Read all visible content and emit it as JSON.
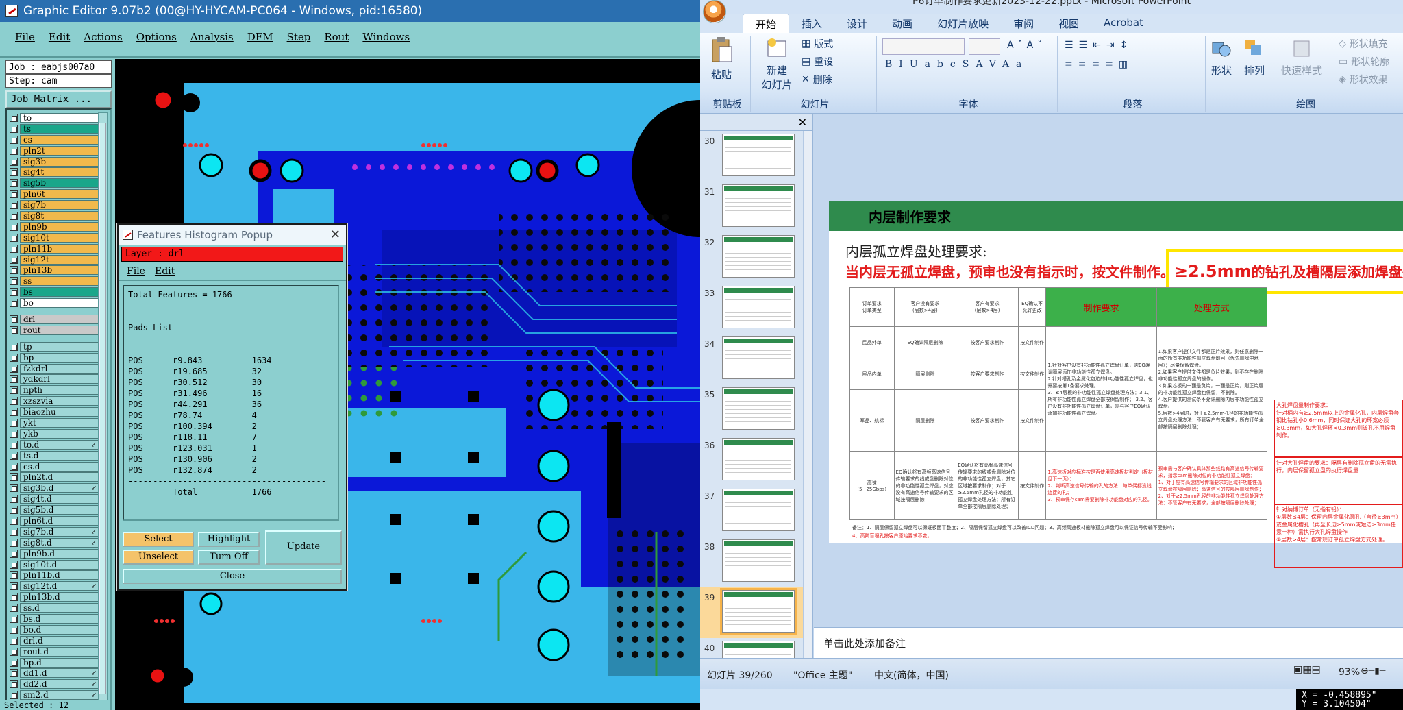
{
  "graphic_editor": {
    "title": "Graphic Editor 9.07b2 (00@HY-HYCAM-PC064 - Windows, pid:16580)",
    "menu": [
      "File",
      "Edit",
      "Actions",
      "Options",
      "Analysis",
      "DFM",
      "Step",
      "Rout",
      "Windows"
    ],
    "job": "Job : eabjs007a0",
    "step": "Step: cam",
    "job_matrix_label": "Job Matrix ...",
    "layers": [
      {
        "name": "to",
        "color": "#ffffff"
      },
      {
        "name": "ts",
        "color": "#1aa68a"
      },
      {
        "name": "cs",
        "color": "#f1b94c"
      },
      {
        "name": "pln2t",
        "color": "#f1b94c"
      },
      {
        "name": "sig3b",
        "color": "#f1b94c"
      },
      {
        "name": "sig4t",
        "color": "#f1b94c"
      },
      {
        "name": "sig5b",
        "color": "#1aa68a"
      },
      {
        "name": "pln6t",
        "color": "#f1b94c"
      },
      {
        "name": "sig7b",
        "color": "#f1b94c"
      },
      {
        "name": "sig8t",
        "color": "#f1b94c"
      },
      {
        "name": "pln9b",
        "color": "#f1b94c"
      },
      {
        "name": "sig10t",
        "color": "#f1b94c"
      },
      {
        "name": "pln11b",
        "color": "#f1b94c"
      },
      {
        "name": "sig12t",
        "color": "#f1b94c"
      },
      {
        "name": "pln13b",
        "color": "#f1b94c"
      },
      {
        "name": "ss",
        "color": "#f1b94c"
      },
      {
        "name": "bs",
        "color": "#1aa68a"
      },
      {
        "name": "bo",
        "color": "#ffffff"
      }
    ],
    "layers_drill": [
      {
        "name": "drl",
        "color": "#c9c9c9"
      },
      {
        "name": "rout",
        "color": "#c9c9c9"
      }
    ],
    "layers_misc": [
      {
        "name": "tp",
        "arrow": ""
      },
      {
        "name": "bp",
        "arrow": ""
      },
      {
        "name": "fzkdrl",
        "arrow": ""
      },
      {
        "name": "ydkdrl",
        "arrow": ""
      },
      {
        "name": "npth",
        "arrow": ""
      },
      {
        "name": "xzszvia",
        "arrow": ""
      },
      {
        "name": "biaozhu",
        "arrow": ""
      },
      {
        "name": "ykt",
        "arrow": ""
      },
      {
        "name": "ykb",
        "arrow": ""
      },
      {
        "name": "to.d",
        "arrow": "↙"
      },
      {
        "name": "ts.d",
        "arrow": ""
      },
      {
        "name": "cs.d",
        "arrow": ""
      },
      {
        "name": "pln2t.d",
        "arrow": ""
      },
      {
        "name": "sig3b.d",
        "arrow": "↙"
      },
      {
        "name": "sig4t.d",
        "arrow": ""
      },
      {
        "name": "sig5b.d",
        "arrow": ""
      },
      {
        "name": "pln6t.d",
        "arrow": ""
      },
      {
        "name": "sig7b.d",
        "arrow": "↙"
      },
      {
        "name": "sig8t.d",
        "arrow": "↙"
      },
      {
        "name": "pln9b.d",
        "arrow": ""
      },
      {
        "name": "sig10t.d",
        "arrow": ""
      },
      {
        "name": "pln11b.d",
        "arrow": ""
      },
      {
        "name": "sig12t.d",
        "arrow": "↙"
      },
      {
        "name": "pln13b.d",
        "arrow": ""
      },
      {
        "name": "ss.d",
        "arrow": ""
      },
      {
        "name": "bs.d",
        "arrow": ""
      },
      {
        "name": "bo.d",
        "arrow": ""
      },
      {
        "name": "drl.d",
        "arrow": ""
      },
      {
        "name": "rout.d",
        "arrow": ""
      },
      {
        "name": "bp.d",
        "arrow": ""
      },
      {
        "name": "dd1.d",
        "arrow": "↙"
      },
      {
        "name": "dd2.d",
        "arrow": "↙"
      },
      {
        "name": "sm2.d",
        "arrow": "↙"
      }
    ],
    "selected_label": "Selected : 12",
    "coords": {
      "x": "X = -0.458895\"",
      "y": "Y = 3.104504\""
    }
  },
  "popup": {
    "title": "Features Histogram Popup",
    "layer_label": "Layer : drl",
    "menu": [
      "File",
      "Edit"
    ],
    "text": "Total Features = 1766\n\n\nPads List\n---------\n\nPOS      r9.843          1634\nPOS      r19.685         32\nPOS      r30.512         30\nPOS      r31.496         16\nPOS      r44.291         36\nPOS      r78.74          4\nPOS      r100.394        2\nPOS      r118.11         7\nPOS      r123.031        1\nPOS      r130.906        2\nPOS      r132.874        2\n----------------------------------------\n         Total           1766",
    "buttons": {
      "select": "Select",
      "highlight": "Highlight",
      "update": "Update",
      "unselect": "Unselect",
      "turn_off": "Turn Off",
      "close": "Close"
    }
  },
  "powerpoint": {
    "title": "P6订单制作要求更新2023-12-22.pptx - Microsoft PowerPoint",
    "tabs": [
      "开始",
      "插入",
      "设计",
      "动画",
      "幻灯片放映",
      "审阅",
      "视图",
      "Acrobat"
    ],
    "groups": {
      "clipboard": "剪贴板",
      "slides": "幻灯片",
      "font": "字体",
      "paragraph": "段落",
      "drawing": "绘图"
    },
    "buttons": {
      "paste": "粘贴",
      "new_slide_1": "新建",
      "new_slide_2": "幻灯片",
      "layout": "版式",
      "reset": "重设",
      "delete": "删除",
      "shape": "形状",
      "arrange": "排列",
      "quick_style": "快速样式",
      "shape_fill": "形状填充",
      "shape_outline": "形状轮廓",
      "shape_effect": "形状效果"
    },
    "thumb_numbers": [
      "30",
      "31",
      "32",
      "33",
      "34",
      "35",
      "36",
      "37",
      "38",
      "39",
      "40"
    ],
    "slide": {
      "title": "内层制作要求",
      "subtitle": "内层孤立焊盘处理要求:",
      "red_line": "当内层无孤立焊盘，预审也没有指示时，按文件制作。",
      "red_big": "≥2.5mm",
      "red_tail": "的钻孔及槽隔层添加焊盘处理",
      "table_head": [
        "订单要求\n订单类型",
        "客户没有要求\n(层数>4层)",
        "客户有要求\n(层数>4层)",
        "EQ确认不允许更改",
        "制作要求",
        "处理方式"
      ],
      "rows": [
        {
          "type": "民品外单",
          "c1": "EQ确认隔层删除",
          "c2": "按客户要求制作",
          "c3": "按文件制作"
        },
        {
          "type": "民品内单",
          "c1": "隔层删除",
          "c2": "按客户要求制作",
          "c3": "按文件制作"
        },
        {
          "type": "军品、航标",
          "c1": "隔层删除",
          "c2": "按客户要求制作",
          "c3": "按文件制作"
        },
        {
          "type": "高速\n(5~25Gbps)",
          "c1": "EQ确认将有高频高速信号传输要求的线或盘删除对位的非功能性孤立焊盘，对应没有高速信号传输要求的区域按隔层删除",
          "c2": "EQ确认将有高频高速信号传输要求的线或盘删除对位的非功能性孤立焊盘，其它区域按要求制作；对于≥2.5mm孔径的非功能性孤立焊盘处理方法：所有订单全部按隔层删除处理；",
          "c3": "按文件制作"
        }
      ],
      "req_col": "1.针对客户没有非功能性孤立焊盘订单，需EQ确认隔层添加非功能性孤立焊盘。\n2.针对槽孔及金属化包边的非功能性孤立焊盘，也需要按第1条要求处理。\n3、≤4层板的非功能性孤立焊盘处理方法：3.1、所有非功能性孤立焊盘全部按保留制作； 3.2、客户没有非功能性孤立焊盘订单，需与客户EQ确认添加非功能性孤立焊盘。",
      "proc_col": "1.如果客户提供文件都是正片效果，则任意删除一面的所有非功能性孤立焊盘即可（优先删除电地层）；尽量保留焊盘。\n2.如果客户提供文件都是负片效果，则不存在删除非功能性孤立焊盘的操作。\n3.如果芯板的一面是负片，一面是正片，则正片层的非功能性孤立焊盘也保留，不删除。\n4.客户提供的测试条不允许删除内层非功能性孤立焊盘。\n5.层数>4层时，对于≥2.5mm孔径的非功能性孤立焊盘处理方法：不管客户有无要求，所有订单全部按隔层删除处理；",
      "high_req": "1.高速板对应标准按是否使用高速板材判定（板材见下一页）：\n2、判断高速信号传输的孔的方法：与单偶都没线连接的孔；\n3、预审保存cam需要删除非功能盘对应的孔径。",
      "high_proc": "预审需与客户确认具体那些线路有高速信号传输要求，指示cam删除对位的非功能性孤立焊盘：\n1、对于应有高速信号传输要求的区域非功能性孤立焊盘按隔层删除；高速信号的按隔层删除制作；\n2、对于≥2.5mm孔径的非功能性孤立焊盘处理方法：不管客户有无要求，全部按隔层删除处理；",
      "note1": "备注：1、隔层保留孤立焊盘可以保证板面平整度；2、隔层保留孤立焊盘可以改善ICD问题；3、高频高速板材删除孤立焊盘可以保证信号传输不受影响；",
      "note2": "4、高阶盲埋孔按客户原始要求不变。",
      "side1": "大孔焊盘量制作要求：\n针对柄内有≥2.5mm以上的金属化孔，内层焊盘套钢比钻孔小0.6mm，同时保证大孔的环宽必须≥0.3mm，如大孔焊环<0.3mm则该孔不用焊盘制作。",
      "side2": "针对大孔焊盘的要求：隔层有删除孤立盘的无需执行，内层保留孤立盘的执行焊盘量",
      "side3": "针对纳博订单（无指有铅）：\n①层数≤4层：保留内层金属化圆孔（直径≥3mm）或金属化槽孔（再至长边≥5mm或短边≥3mm任意一种）需执行大孔焊盘操作\n②层数>4层：按常规订单孤立焊盘方式处理。"
    },
    "notes_placeholder": "单击此处添加备注",
    "status": {
      "slide": "幻灯片 39/260",
      "theme": "\"Office 主题\"",
      "lang": "中文(简体，中国)",
      "zoom": "93%"
    }
  }
}
